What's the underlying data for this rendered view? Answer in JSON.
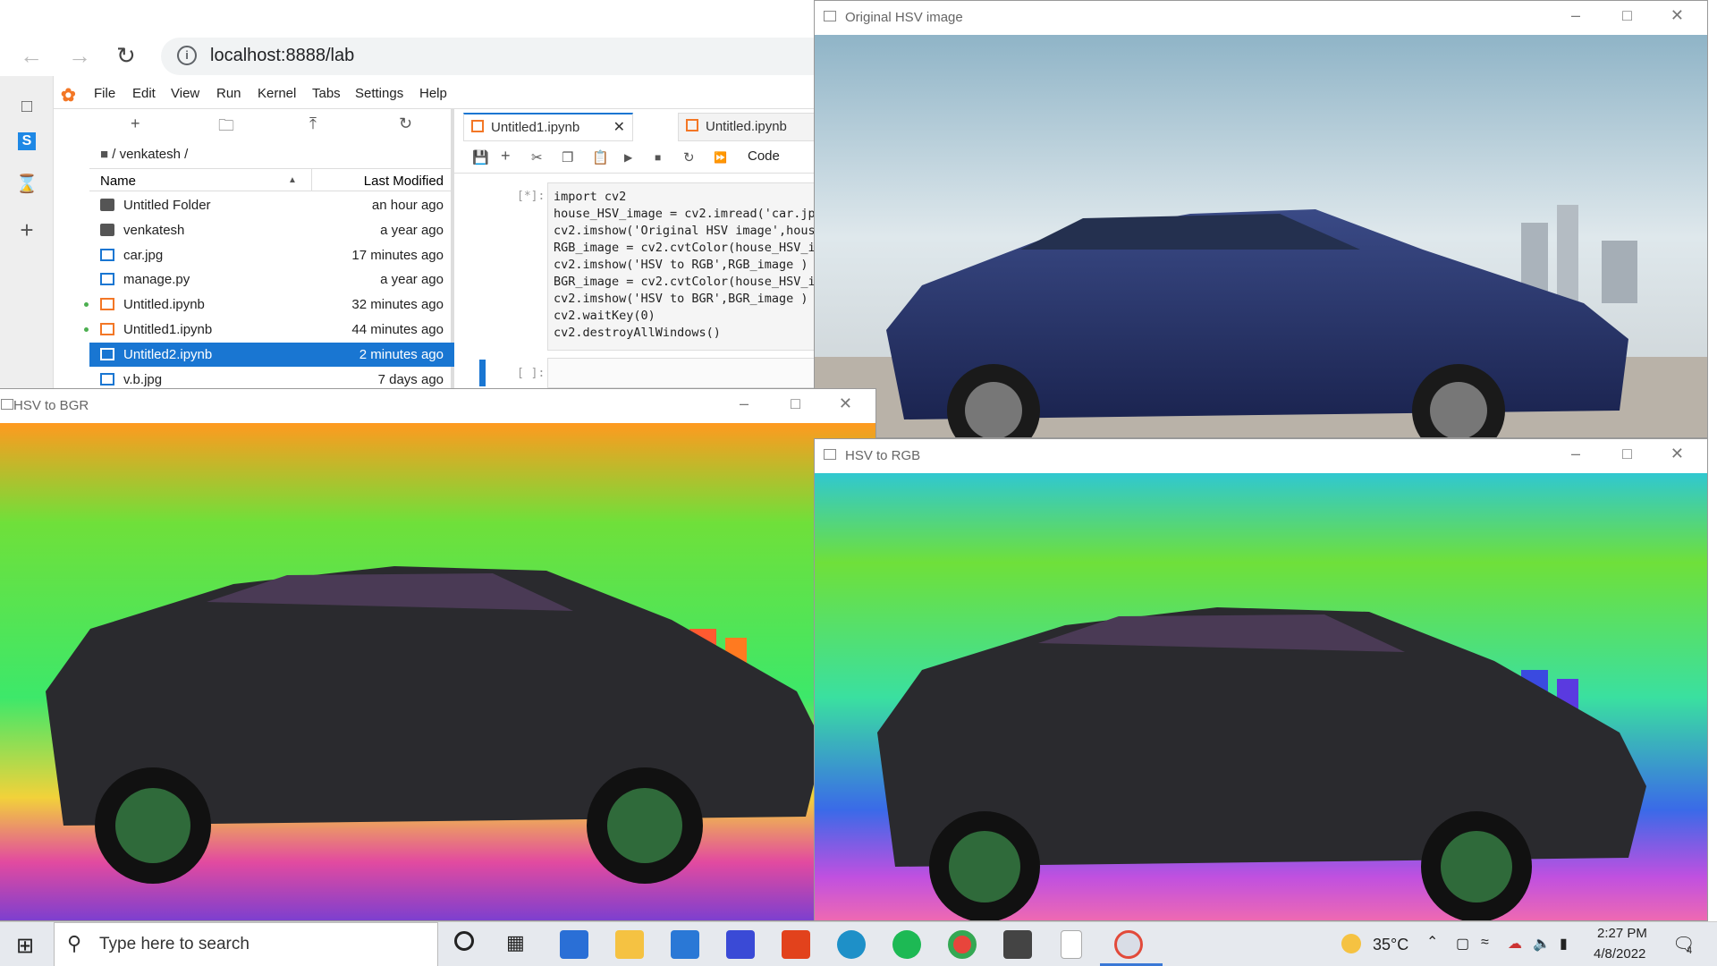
{
  "browser": {
    "url": "localhost:8888/lab"
  },
  "jupyter": {
    "menu": [
      "File",
      "Edit",
      "View",
      "Run",
      "Kernel",
      "Tabs",
      "Settings",
      "Help"
    ],
    "breadcrumb": "/ venkatesh /",
    "columns": {
      "name": "Name",
      "modified": "Last Modified"
    },
    "files": [
      {
        "name": "Untitled Folder",
        "modified": "an hour ago",
        "type": "folder"
      },
      {
        "name": "venkatesh",
        "modified": "a year ago",
        "type": "folder"
      },
      {
        "name": "car.jpg",
        "modified": "17 minutes ago",
        "type": "image"
      },
      {
        "name": "manage.py",
        "modified": "a year ago",
        "type": "python"
      },
      {
        "name": "Untitled.ipynb",
        "modified": "32 minutes ago",
        "type": "notebook"
      },
      {
        "name": "Untitled1.ipynb",
        "modified": "44 minutes ago",
        "type": "notebook"
      },
      {
        "name": "Untitled2.ipynb",
        "modified": "2 minutes ago",
        "type": "notebook"
      },
      {
        "name": "v.b.jpg",
        "modified": "7 days ago",
        "type": "image"
      }
    ],
    "tabs": [
      "Untitled1.ipynb",
      "Untitled.ipynb"
    ],
    "cell_type": "Code",
    "prompt_running": "[*]:",
    "prompt_empty": "[ ]:",
    "code": [
      "import cv2",
      "house_HSV_image = cv2.imread('car.jp",
      "cv2.imshow('Original HSV image',hous",
      "RGB_image = cv2.cvtColor(house_HSV_i",
      "cv2.imshow('HSV to RGB',RGB_image )",
      "BGR_image = cv2.cvtColor(house_HSV_i",
      "cv2.imshow('HSV to BGR',BGR_image )",
      "cv2.waitKey(0)",
      "cv2.destroyAllWindows()"
    ]
  },
  "windows": {
    "original": {
      "title": "Original HSV image"
    },
    "bgr": {
      "title": "HSV to BGR"
    },
    "rgb": {
      "title": "HSV to RGB"
    }
  },
  "taskbar": {
    "search_placeholder": "Type here to search",
    "weather": "35°C",
    "time": "2:27 PM",
    "date": "4/8/2022",
    "notifications": "4"
  }
}
